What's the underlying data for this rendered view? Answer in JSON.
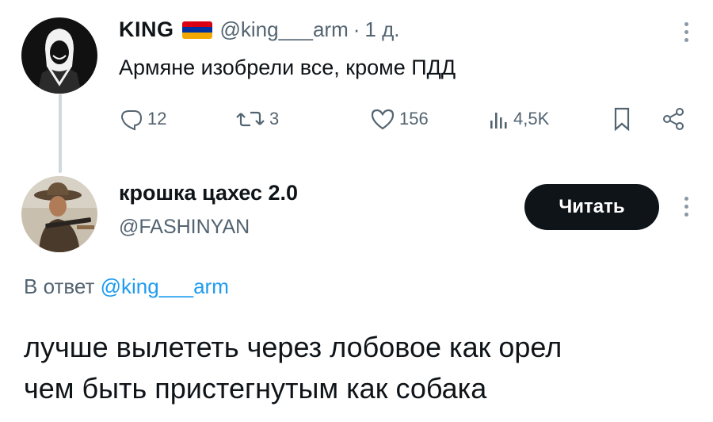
{
  "tweet1": {
    "author_name": "KING",
    "flag_icon": "armenia-flag-icon",
    "handle": "@king___arm",
    "separator": "·",
    "time": "1 д.",
    "text": "Армяне изобрели все, кроме ПДД",
    "actions": {
      "replies": "12",
      "retweets": "3",
      "likes": "156",
      "views": "4,5K"
    }
  },
  "tweet2": {
    "author_name": "крошка цахес 2.0",
    "handle": "@FASHINYAN",
    "follow_label": "Читать",
    "reply_prefix": "В ответ",
    "reply_mention": "@king___arm",
    "text_lines": [
      "лучше вылететь через лобовое как орел",
      "чем быть пристегнутым как собака"
    ]
  },
  "colors": {
    "text": "#0f1419",
    "secondary": "#536471",
    "link": "#1d9bf0",
    "button_bg": "#0f1419",
    "thread_line": "#cfd9de"
  }
}
